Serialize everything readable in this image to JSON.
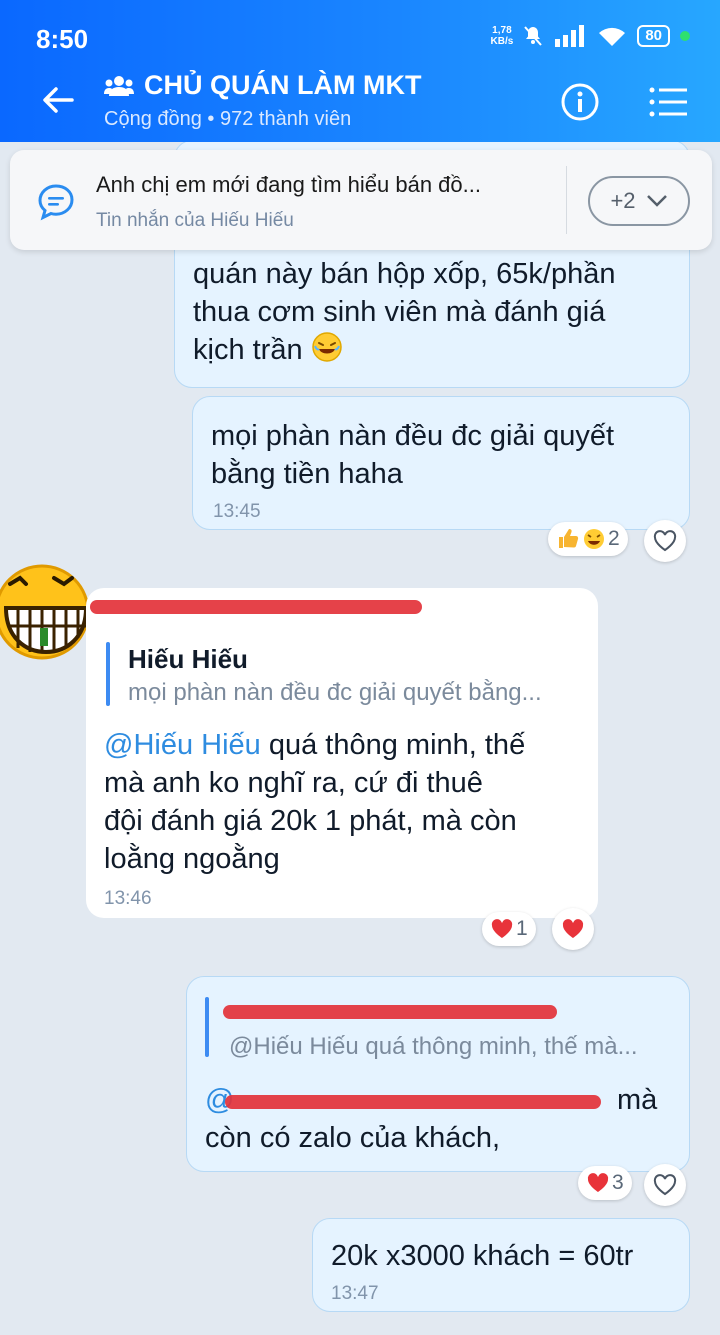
{
  "status_bar": {
    "time": "8:50",
    "net_speed": "1,78",
    "net_unit": "KB/s",
    "battery": "80"
  },
  "header": {
    "title": "CHỦ QUÁN LÀM MKT",
    "subtitle": "Cộng đồng • 972 thành viên"
  },
  "pinned": {
    "text": "Anh chị em mới đang tìm hiểu bán đồ...",
    "sender": "Tin nhắn của Hiếu Hiếu",
    "more": "+2"
  },
  "messages": {
    "m1": {
      "line1": "quán này bán hộp xốp, 65k/phần",
      "line2": "thua cơm sinh viên mà đánh giá",
      "line3": "kịch trần"
    },
    "m2": {
      "line1": "mọi phàn nàn đều đc giải quyết",
      "line2": "bằng tiền haha",
      "time": "13:45",
      "react_count": "2"
    },
    "m3": {
      "quote_name": "Hiếu Hiếu",
      "quote_text": "mọi phàn nàn đều đc giải quyết bằng...",
      "mention": "@Hiếu Hiếu",
      "line1_rest": " quá thông minh, thế",
      "line2": "mà anh ko nghĩ ra, cứ đi thuê",
      "line3": "đội đánh giá 20k 1 phát, mà còn",
      "line4": "loằng ngoằng",
      "time": "13:46",
      "react_count": "1"
    },
    "m4": {
      "quote_text": "@Hiếu Hiếu quá thông minh, thế mà...",
      "mention_start": "@",
      "line1_end": "mà",
      "line2": "còn có zalo của khách,",
      "react_count": "3"
    },
    "m5": {
      "text": "20k x3000 khách = 60tr",
      "time": "13:47"
    }
  },
  "colors": {
    "header_start": "#0a68ff",
    "header_end": "#27a7ff",
    "outgoing_bubble": "#e5f3ff",
    "mention": "#2e8ce0",
    "redaction": "#e3323a"
  }
}
